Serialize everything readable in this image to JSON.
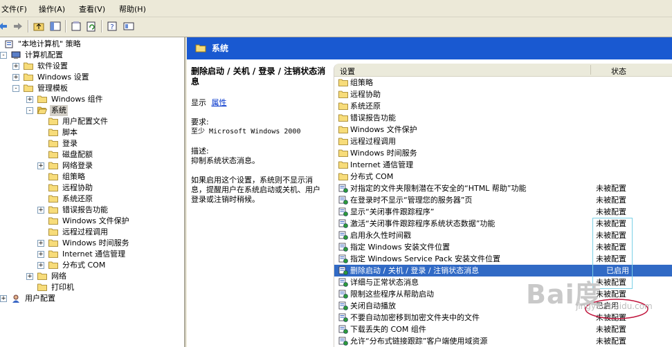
{
  "menu": [
    "文件(F)",
    "操作(A)",
    "查看(V)",
    "帮助(H)"
  ],
  "tree": [
    {
      "label": "\"本地计算机\" 策略",
      "lvl": 0,
      "exp": null,
      "icon": "policy"
    },
    {
      "label": "计算机配置",
      "lvl": 1,
      "exp": "-",
      "icon": "computer"
    },
    {
      "label": "软件设置",
      "lvl": 2,
      "exp": "+",
      "icon": "folder"
    },
    {
      "label": "Windows 设置",
      "lvl": 2,
      "exp": "+",
      "icon": "folder"
    },
    {
      "label": "管理模板",
      "lvl": 2,
      "exp": "-",
      "icon": "folder"
    },
    {
      "label": "Windows 组件",
      "lvl": 3,
      "exp": "+",
      "icon": "folder"
    },
    {
      "label": "系统",
      "lvl": 3,
      "exp": "-",
      "icon": "folder-open",
      "selected": true
    },
    {
      "label": "用户配置文件",
      "lvl": 4,
      "exp": null,
      "icon": "folder"
    },
    {
      "label": "脚本",
      "lvl": 4,
      "exp": null,
      "icon": "folder"
    },
    {
      "label": "登录",
      "lvl": 4,
      "exp": null,
      "icon": "folder"
    },
    {
      "label": "磁盘配额",
      "lvl": 4,
      "exp": null,
      "icon": "folder"
    },
    {
      "label": "网络登录",
      "lvl": 4,
      "exp": "+",
      "icon": "folder"
    },
    {
      "label": "组策略",
      "lvl": 4,
      "exp": null,
      "icon": "folder"
    },
    {
      "label": "远程协助",
      "lvl": 4,
      "exp": null,
      "icon": "folder"
    },
    {
      "label": "系统还原",
      "lvl": 4,
      "exp": null,
      "icon": "folder"
    },
    {
      "label": "错误报告功能",
      "lvl": 4,
      "exp": "+",
      "icon": "folder"
    },
    {
      "label": "Windows 文件保护",
      "lvl": 4,
      "exp": null,
      "icon": "folder"
    },
    {
      "label": "远程过程调用",
      "lvl": 4,
      "exp": null,
      "icon": "folder"
    },
    {
      "label": "Windows 时间服务",
      "lvl": 4,
      "exp": "+",
      "icon": "folder"
    },
    {
      "label": "Internet 通信管理",
      "lvl": 4,
      "exp": "+",
      "icon": "folder"
    },
    {
      "label": "分布式 COM",
      "lvl": 4,
      "exp": "+",
      "icon": "folder"
    },
    {
      "label": "网络",
      "lvl": 3,
      "exp": "+",
      "icon": "folder"
    },
    {
      "label": "打印机",
      "lvl": 3,
      "exp": null,
      "icon": "folder"
    },
    {
      "label": "用户配置",
      "lvl": 1,
      "exp": "+",
      "icon": "user"
    }
  ],
  "header": {
    "title": "系统"
  },
  "description": {
    "title": "删除启动 / 关机 / 登录 / 注销状态消息",
    "show_label": "显示",
    "properties_link": "属性",
    "requires_label": "要求:",
    "requires_value": "至少 Microsoft Windows 2000",
    "desc_label": "描述:",
    "desc_value": "抑制系统状态消息。",
    "detail": "如果启用这个设置，系统则不显示消息，提醒用户在系统启动或关机、用户登录或注销时稍候。"
  },
  "columns": {
    "setting": "设置",
    "state": "状态"
  },
  "rows": [
    {
      "label": "组策略",
      "state": "",
      "type": "folder"
    },
    {
      "label": "远程协助",
      "state": "",
      "type": "folder"
    },
    {
      "label": "系统还原",
      "state": "",
      "type": "folder"
    },
    {
      "label": "错误报告功能",
      "state": "",
      "type": "folder"
    },
    {
      "label": "Windows 文件保护",
      "state": "",
      "type": "folder"
    },
    {
      "label": "远程过程调用",
      "state": "",
      "type": "folder"
    },
    {
      "label": "Windows 时间服务",
      "state": "",
      "type": "folder"
    },
    {
      "label": "Internet 通信管理",
      "state": "",
      "type": "folder"
    },
    {
      "label": "分布式 COM",
      "state": "",
      "type": "folder"
    },
    {
      "label": "对指定的文件夹限制潜在不安全的“HTML 帮助”功能",
      "state": "未被配置",
      "type": "policy"
    },
    {
      "label": "在登录时不显示“管理您的服务器”页",
      "state": "未被配置",
      "type": "policy"
    },
    {
      "label": "显示“关闭事件跟踪程序”",
      "state": "未被配置",
      "type": "policy"
    },
    {
      "label": "激活“关闭事件跟踪程序系统状态数据”功能",
      "state": "未被配置",
      "type": "policy"
    },
    {
      "label": "启用永久性时间戳",
      "state": "未被配置",
      "type": "policy"
    },
    {
      "label": "指定 Windows 安装文件位置",
      "state": "未被配置",
      "type": "policy"
    },
    {
      "label": "指定 Windows Service Pack 安装文件位置",
      "state": "未被配置",
      "type": "policy"
    },
    {
      "label": "删除启动 / 关机 / 登录 / 注销状态消息",
      "state": "已启用",
      "type": "policy",
      "selected": true
    },
    {
      "label": "详细与正常状态消息",
      "state": "未被配置",
      "type": "policy"
    },
    {
      "label": "限制这些程序从帮助启动",
      "state": "未被配置",
      "type": "policy"
    },
    {
      "label": "关闭自动播放",
      "state": "已启用",
      "type": "policy"
    },
    {
      "label": "不要自动加密移到加密文件夹中的文件",
      "state": "未被配置",
      "type": "policy"
    },
    {
      "label": "下载丢失的 COM 组件",
      "state": "未被配置",
      "type": "policy"
    },
    {
      "label": "允许“分布式链接跟踪”客户端使用域资源",
      "state": "未被配置",
      "type": "policy"
    }
  ],
  "watermark": {
    "brand": "Bai度",
    "sub": "jingyan.baidu.com"
  },
  "colors": {
    "header": "#1959d1",
    "selection": "#316ac5",
    "highlight_box": "#7ad0e6",
    "circle": "#c0143c"
  }
}
